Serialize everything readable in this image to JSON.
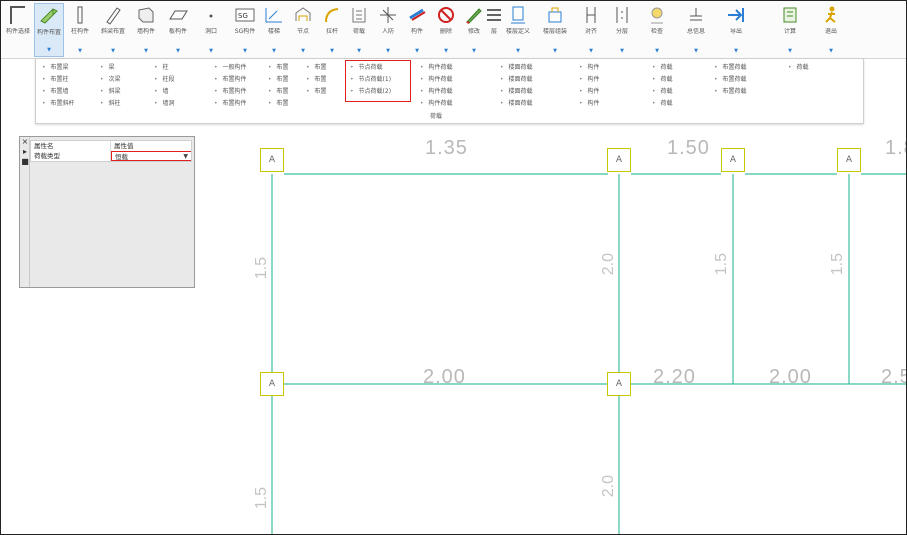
{
  "ribbon": {
    "buttons": [
      {
        "label": "构件选择",
        "icon": "select-icon"
      },
      {
        "label": "构件布置",
        "icon": "beam-icon"
      },
      {
        "label": "柱构件",
        "icon": "column-icon"
      },
      {
        "label": "斜梁布置",
        "icon": "slant-icon"
      },
      {
        "label": "墙构件",
        "icon": "wall-icon"
      },
      {
        "label": "板构件",
        "icon": "slab-icon"
      },
      {
        "label": "洞口",
        "icon": "dot-icon"
      },
      {
        "label": "SG构件",
        "icon": "sg-icon"
      },
      {
        "label": "楼梯",
        "icon": "stair-icon"
      },
      {
        "label": "节点",
        "icon": "node-icon"
      },
      {
        "label": "拉杆",
        "icon": "rod-icon"
      },
      {
        "label": "荷载",
        "icon": "load-icon"
      },
      {
        "label": "人防",
        "icon": "defense-icon"
      },
      {
        "label": "构件",
        "icon": "component-icon"
      },
      {
        "label": "删除",
        "icon": "delete-icon"
      },
      {
        "label": "修改",
        "icon": "edit-icon"
      },
      {
        "label": "层",
        "icon": "layer-icon"
      },
      {
        "label": "楼层定义",
        "icon": "floor-icon"
      },
      {
        "label": "楼层组装",
        "icon": "assemble-icon"
      },
      {
        "label": "对齐",
        "icon": "align-icon"
      },
      {
        "label": "分层",
        "icon": "split-icon"
      },
      {
        "label": "检查",
        "icon": "check-icon"
      },
      {
        "label": "总信息",
        "icon": "info-icon"
      },
      {
        "label": "导出",
        "icon": "export-icon"
      },
      {
        "label": "计算",
        "icon": "calc-icon"
      },
      {
        "label": "退出",
        "icon": "exit-icon"
      }
    ]
  },
  "dropdown": {
    "columns": [
      [
        "布置梁",
        "布置柱",
        "布置墙",
        "布置斜杆"
      ],
      [
        "梁",
        "次梁",
        "斜梁",
        "斜柱"
      ],
      [
        "柱",
        "柱段",
        "墙",
        "墙洞"
      ],
      [
        "一般构件",
        "布置构件",
        "布置构件",
        "布置构件"
      ],
      [
        "布置",
        "布置",
        "布置",
        "布置"
      ],
      [
        "布置",
        "布置",
        "布置"
      ],
      [
        "节点荷载",
        "节点荷载(1)",
        "节点荷载(2)"
      ],
      [
        "构件荷载",
        "构件荷载",
        "构件荷载",
        "构件荷载"
      ],
      [
        "楼面荷载",
        "楼面荷载",
        "楼面荷载",
        "楼面荷载"
      ],
      [
        "构件",
        "构件",
        "构件",
        "构件"
      ],
      [
        "荷载",
        "荷载",
        "荷载",
        "荷载"
      ],
      [
        "布置荷载",
        "布置荷载",
        "布置荷载"
      ],
      [
        "荷载"
      ]
    ],
    "extra_label": "荷载"
  },
  "properties": {
    "side_icons": [
      "close-icon",
      "pin-icon",
      "menu-icon"
    ],
    "header": [
      "属性名",
      "属性值"
    ],
    "row_name": "荷载类型",
    "row_value": "恒载"
  },
  "canvas": {
    "node_label": "A",
    "dims_top": [
      "1.35",
      "1.50",
      "1.8"
    ],
    "dims_mid": [
      "2.00",
      "2.20",
      "2.00",
      "2.5"
    ],
    "vert_labels": [
      "1.5",
      "2.0",
      "1.5",
      "1.5",
      "1.5",
      "2.0"
    ],
    "colors": {
      "line": "#3dbf9f",
      "node_border": "#c8c800",
      "highlight": "#e02020"
    }
  }
}
